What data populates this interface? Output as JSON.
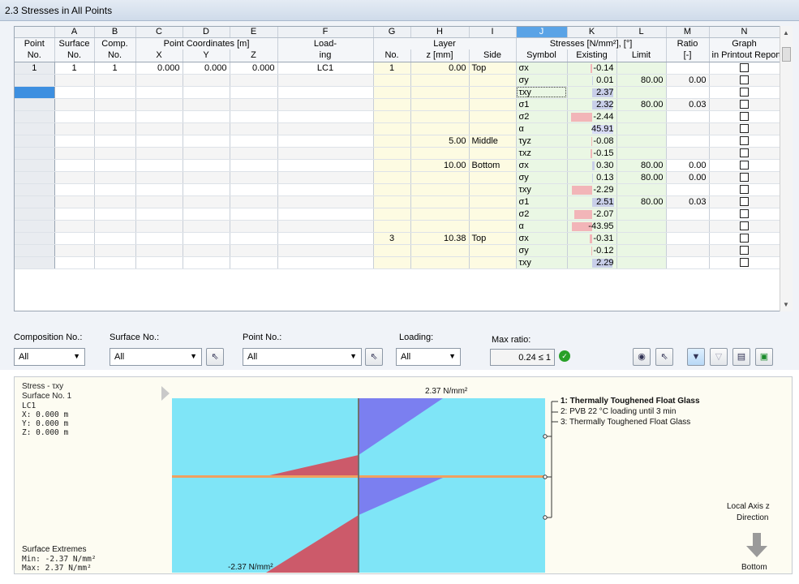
{
  "title": "2.3 Stresses in All Points",
  "columns": {
    "letters": [
      "A",
      "B",
      "C",
      "D",
      "E",
      "F",
      "G",
      "H",
      "I",
      "J",
      "K",
      "L",
      "M",
      "N"
    ],
    "header1": {
      "point": "Point",
      "surface": "Surface",
      "comp": "Comp.",
      "coords": "Point Coordinates [m]",
      "loading": "Load-",
      "layer": "Layer",
      "stresses": "Stresses [N/mm²], [°]",
      "ratio": "Ratio",
      "graph": "Graph"
    },
    "header2": {
      "point": "No.",
      "surface": "No.",
      "comp": "No.",
      "x": "X",
      "y": "Y",
      "z": "Z",
      "loading": "ing",
      "layer_no": "No.",
      "z_mm": "z [mm]",
      "side": "Side",
      "symbol": "Symbol",
      "existing": "Existing",
      "limit": "Limit",
      "ratio": "[-]",
      "graph": "in Printout Report"
    }
  },
  "rows": [
    {
      "point": "1",
      "surface": "1",
      "comp": "1",
      "x": "0.000",
      "y": "0.000",
      "z": "0.000",
      "loading": "LC1",
      "layer": "1",
      "zmm": "0.00",
      "side": "Top",
      "symbol": "σx",
      "existing": "-0.14",
      "limit": "",
      "ratio": "",
      "val": -0.14
    },
    {
      "point": "",
      "surface": "",
      "comp": "",
      "x": "",
      "y": "",
      "z": "",
      "loading": "",
      "layer": "",
      "zmm": "",
      "side": "",
      "symbol": "σy",
      "existing": "0.01",
      "limit": "80.00",
      "ratio": "0.00",
      "val": 0.01
    },
    {
      "point": "",
      "surface": "",
      "comp": "",
      "x": "",
      "y": "",
      "z": "",
      "loading": "",
      "layer": "",
      "zmm": "",
      "side": "",
      "symbol": "τxy",
      "existing": "2.37",
      "limit": "",
      "ratio": "",
      "val": 2.37
    },
    {
      "point": "",
      "surface": "",
      "comp": "",
      "x": "",
      "y": "",
      "z": "",
      "loading": "",
      "layer": "",
      "zmm": "",
      "side": "",
      "symbol": "σ1",
      "existing": "2.32",
      "limit": "80.00",
      "ratio": "0.03",
      "val": 2.32
    },
    {
      "point": "",
      "surface": "",
      "comp": "",
      "x": "",
      "y": "",
      "z": "",
      "loading": "",
      "layer": "",
      "zmm": "",
      "side": "",
      "symbol": "σ2",
      "existing": "-2.44",
      "limit": "",
      "ratio": "",
      "val": -2.44
    },
    {
      "point": "",
      "surface": "",
      "comp": "",
      "x": "",
      "y": "",
      "z": "",
      "loading": "",
      "layer": "",
      "zmm": "",
      "side": "",
      "symbol": "α",
      "existing": "45.91",
      "limit": "",
      "ratio": "",
      "val": 45.91
    },
    {
      "point": "",
      "surface": "",
      "comp": "",
      "x": "",
      "y": "",
      "z": "",
      "loading": "",
      "layer": "",
      "zmm": "5.00",
      "side": "Middle",
      "symbol": "τyz",
      "existing": "-0.08",
      "limit": "",
      "ratio": "",
      "val": -0.08
    },
    {
      "point": "",
      "surface": "",
      "comp": "",
      "x": "",
      "y": "",
      "z": "",
      "loading": "",
      "layer": "",
      "zmm": "",
      "side": "",
      "symbol": "τxz",
      "existing": "-0.15",
      "limit": "",
      "ratio": "",
      "val": -0.15
    },
    {
      "point": "",
      "surface": "",
      "comp": "",
      "x": "",
      "y": "",
      "z": "",
      "loading": "",
      "layer": "",
      "zmm": "10.00",
      "side": "Bottom",
      "symbol": "σx",
      "existing": "0.30",
      "limit": "80.00",
      "ratio": "0.00",
      "val": 0.3
    },
    {
      "point": "",
      "surface": "",
      "comp": "",
      "x": "",
      "y": "",
      "z": "",
      "loading": "",
      "layer": "",
      "zmm": "",
      "side": "",
      "symbol": "σy",
      "existing": "0.13",
      "limit": "80.00",
      "ratio": "0.00",
      "val": 0.13
    },
    {
      "point": "",
      "surface": "",
      "comp": "",
      "x": "",
      "y": "",
      "z": "",
      "loading": "",
      "layer": "",
      "zmm": "",
      "side": "",
      "symbol": "τxy",
      "existing": "-2.29",
      "limit": "",
      "ratio": "",
      "val": -2.29
    },
    {
      "point": "",
      "surface": "",
      "comp": "",
      "x": "",
      "y": "",
      "z": "",
      "loading": "",
      "layer": "",
      "zmm": "",
      "side": "",
      "symbol": "σ1",
      "existing": "2.51",
      "limit": "80.00",
      "ratio": "0.03",
      "val": 2.51
    },
    {
      "point": "",
      "surface": "",
      "comp": "",
      "x": "",
      "y": "",
      "z": "",
      "loading": "",
      "layer": "",
      "zmm": "",
      "side": "",
      "symbol": "σ2",
      "existing": "-2.07",
      "limit": "",
      "ratio": "",
      "val": -2.07
    },
    {
      "point": "",
      "surface": "",
      "comp": "",
      "x": "",
      "y": "",
      "z": "",
      "loading": "",
      "layer": "",
      "zmm": "",
      "side": "",
      "symbol": "α",
      "existing": "-43.95",
      "limit": "",
      "ratio": "",
      "val": -43.95
    },
    {
      "point": "",
      "surface": "",
      "comp": "",
      "x": "",
      "y": "",
      "z": "",
      "loading": "",
      "layer": "3",
      "zmm": "10.38",
      "side": "Top",
      "symbol": "σx",
      "existing": "-0.31",
      "limit": "",
      "ratio": "",
      "val": -0.31
    },
    {
      "point": "",
      "surface": "",
      "comp": "",
      "x": "",
      "y": "",
      "z": "",
      "loading": "",
      "layer": "",
      "zmm": "",
      "side": "",
      "symbol": "σy",
      "existing": "-0.12",
      "limit": "",
      "ratio": "",
      "val": -0.12
    },
    {
      "point": "",
      "surface": "",
      "comp": "",
      "x": "",
      "y": "",
      "z": "",
      "loading": "",
      "layer": "",
      "zmm": "",
      "side": "",
      "symbol": "τxy",
      "existing": "2.29",
      "limit": "",
      "ratio": "",
      "val": 2.29
    }
  ],
  "filters": {
    "composition_label": "Composition No.:",
    "composition_value": "All",
    "surface_label": "Surface No.:",
    "surface_value": "All",
    "point_label": "Point No.:",
    "point_value": "All",
    "loading_label": "Loading:",
    "loading_value": "All",
    "maxratio_label": "Max ratio:",
    "maxratio_value": "0.24",
    "maxratio_cmp": "≤ 1"
  },
  "graphic": {
    "title": "Stress - τxy",
    "surface": "Surface No. 1",
    "loadcase": "LC1",
    "x": "X: 0.000  m",
    "y": "Y: 0.000  m",
    "z": "Z: 0.000  m",
    "top_value": "2.37 N/mm²",
    "bottom_value": "-2.37 N/mm²",
    "layers": [
      "1: Thermally Toughened Float Glass",
      "2: PVB 22 °C loading until 3 min",
      "3: Thermally Toughened Float Glass"
    ],
    "extremes_label": "Surface Extremes",
    "min": "Min:  -2.37 N/mm²",
    "max": "Max:   2.37 N/mm²",
    "axis_label_1": "Local Axis z",
    "axis_label_2": "Direction",
    "axis_end": "Bottom"
  },
  "colors": {
    "glass": "#7fe5f7",
    "positive": "#7b7ff0",
    "negative": "#cc5a6a",
    "interlayer": "#f0a060",
    "header_sel": "#5aa3e6"
  }
}
